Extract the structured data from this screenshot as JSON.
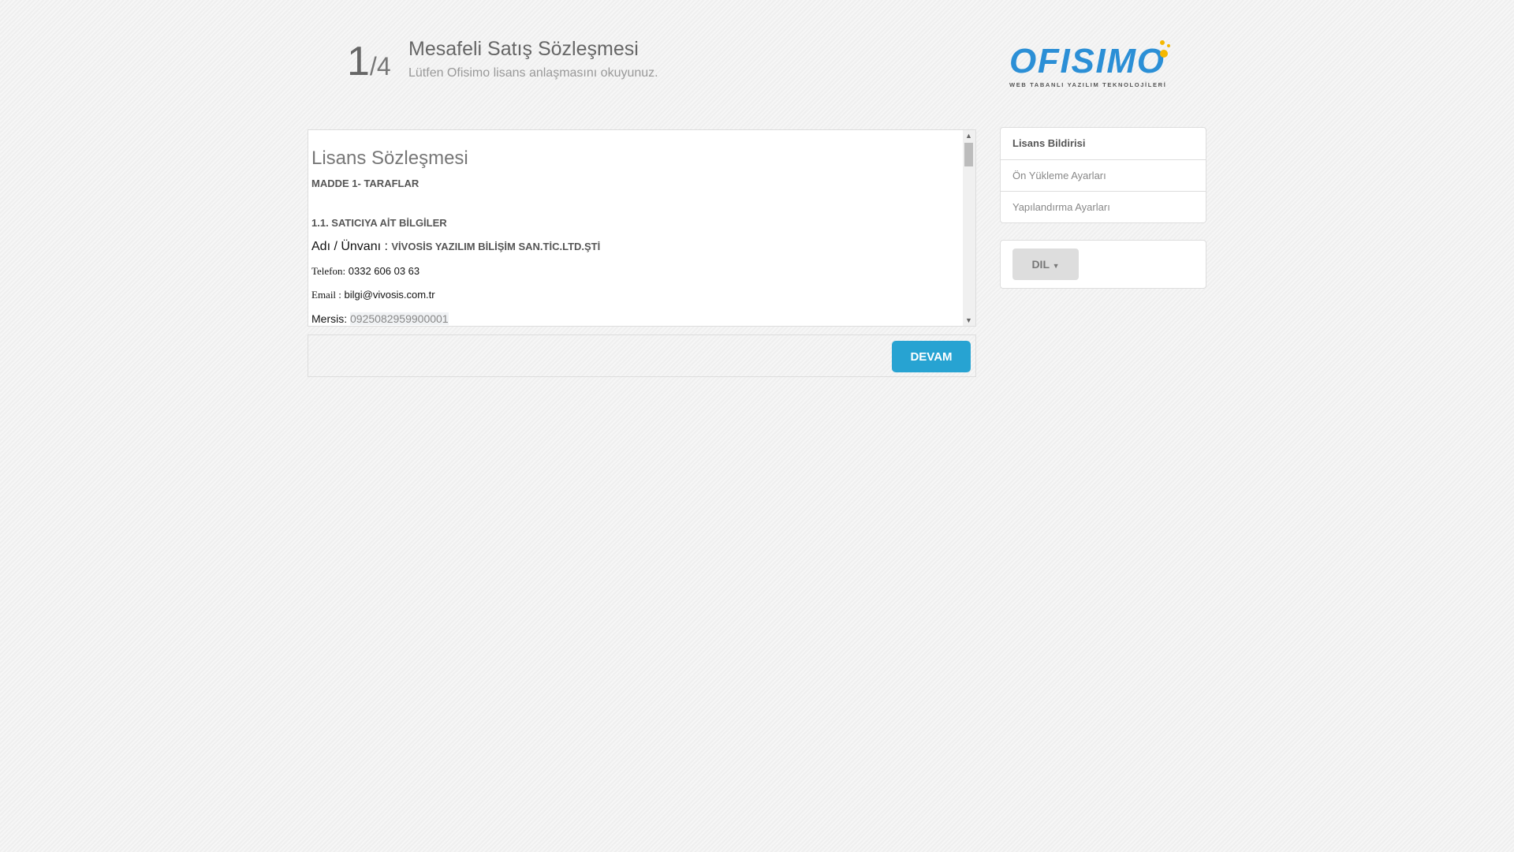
{
  "header": {
    "step_current": "1",
    "step_total": "/4",
    "title": "Mesafeli Satış Sözleşmesi",
    "subtitle": "Lütfen Ofisimo lisans anlaşmasını okuyunuz."
  },
  "logo": {
    "name": "OFISIMO",
    "tagline": "WEB TABANLI YAZILIM TEKNOLOJİLERİ"
  },
  "contract": {
    "heading": "Lisans Sözleşmesi",
    "article": "MADDE 1- TARAFLAR",
    "section": "1.1. SATICIYA AİT BİLGİLER",
    "name_label": "Adı / Ünvanı :",
    "name_value": "VİVOSİS YAZILIM BİLİŞİM SAN.TİC.LTD.ŞTİ",
    "phone_label": "Telefon:",
    "phone_value": "0332 606 03 63",
    "email_label": "Email :",
    "email_value": "bilgi@vivosis.com.tr",
    "mersis_label": "Mersis:",
    "mersis_value": "0925082959900001"
  },
  "footer": {
    "continue_label": "DEVAM"
  },
  "sidebar": {
    "items": [
      {
        "label": "Lisans Bildirisi"
      },
      {
        "label": "Ön Yükleme Ayarları"
      },
      {
        "label": "Yapılandırma Ayarları"
      }
    ],
    "language_label": "DIL"
  },
  "colors": {
    "accent": "#27a3d2",
    "logo_blue": "#2b8fd6",
    "logo_yellow": "#f5b800"
  }
}
